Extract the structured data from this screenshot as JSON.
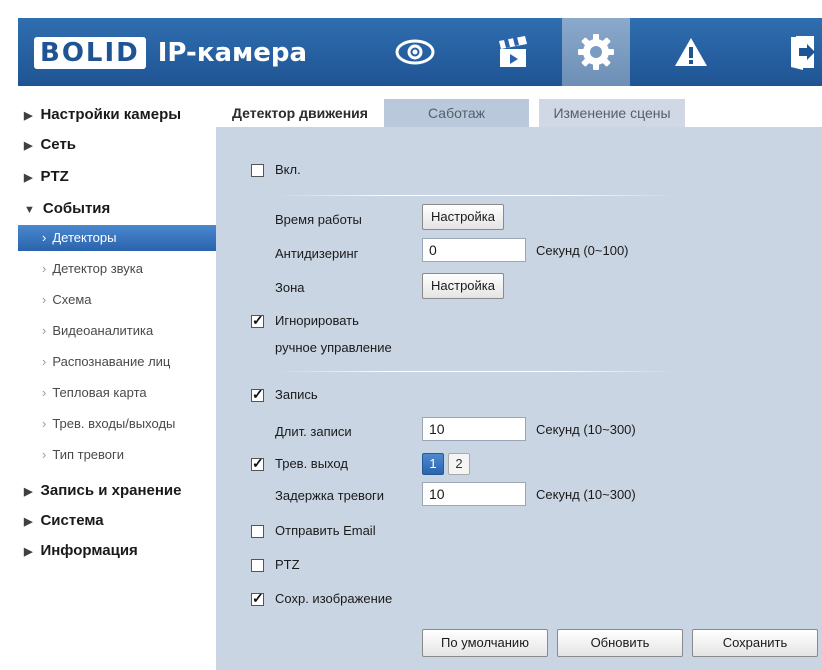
{
  "header": {
    "logo_box": "BOLID",
    "logo_text": "IP-камера",
    "icons": [
      "eye-icon",
      "clapperboard-icon",
      "gear-icon",
      "warning-icon",
      "logout-icon"
    ]
  },
  "sidebar": {
    "items": [
      {
        "label": "Настройки камеры"
      },
      {
        "label": "Сеть"
      },
      {
        "label": "PTZ"
      },
      {
        "label": "События"
      },
      {
        "label": "Запись и хранение"
      },
      {
        "label": "Система"
      },
      {
        "label": "Информация"
      }
    ],
    "sub_items": [
      {
        "label": "Детекторы"
      },
      {
        "label": "Детектор звука"
      },
      {
        "label": "Схема"
      },
      {
        "label": "Видеоаналитика"
      },
      {
        "label": "Распознавание лиц"
      },
      {
        "label": "Тепловая карта"
      },
      {
        "label": "Трев. входы/выходы"
      },
      {
        "label": "Тип тревоги"
      }
    ]
  },
  "tabs": [
    {
      "label": "Детектор движения"
    },
    {
      "label": "Саботаж"
    },
    {
      "label": "Изменение сцены"
    }
  ],
  "form": {
    "enable_label": "Вкл.",
    "work_time_label": "Время работы",
    "setup_label": "Настройка",
    "antidither_label": "Антидизеринг",
    "antidither_value": "0",
    "antidither_unit": "Секунд (0~100)",
    "zone_label": "Зона",
    "ignore_label_1": "Игнорировать",
    "ignore_label_2": "ручное управление",
    "record_label": "Запись",
    "record_duration_label": "Длит. записи",
    "record_duration_value": "10",
    "record_duration_unit": "Секунд (10~300)",
    "alarm_out_label": "Трев. выход",
    "alarm_out_1": "1",
    "alarm_out_2": "2",
    "alarm_delay_label": "Задержка тревоги",
    "alarm_delay_value": "10",
    "alarm_delay_unit": "Секунд (10~300)",
    "email_label": "Отправить Email",
    "ptz_label": "PTZ",
    "snapshot_label": "Сохр. изображение"
  },
  "footer": {
    "default_label": "По умолчанию",
    "refresh_label": "Обновить",
    "save_label": "Сохранить"
  },
  "colors": {
    "header_blue": "#1f5494",
    "panel_bg": "#cad5e3",
    "active_item": "#2a63ac"
  }
}
